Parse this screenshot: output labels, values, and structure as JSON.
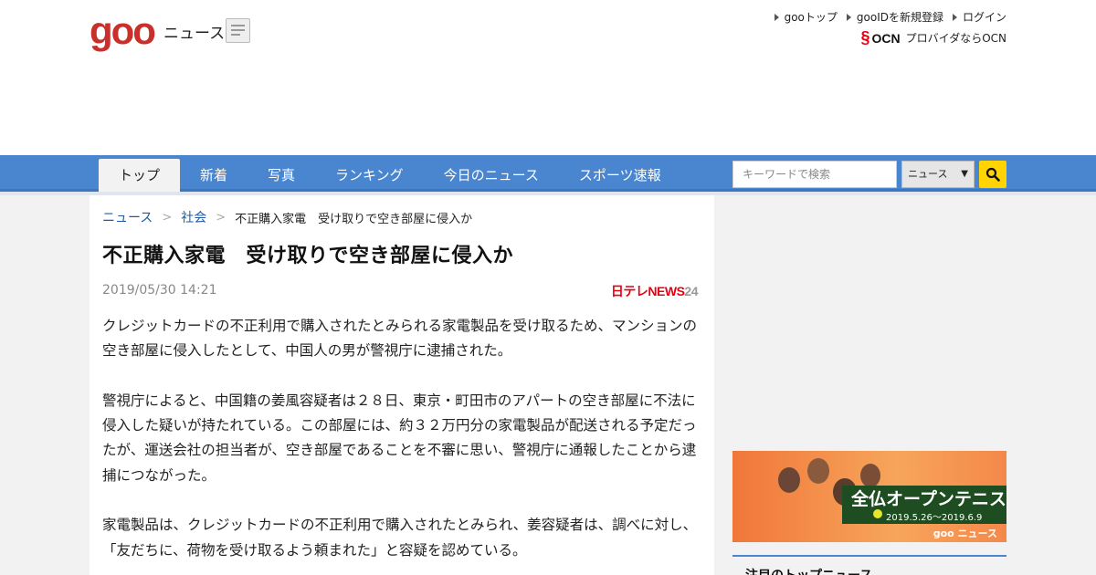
{
  "header": {
    "logo_text": "goo",
    "service_name": "ニュース",
    "util_links": [
      "gooトップ",
      "gooIDを新規登録",
      "ログイン"
    ],
    "ocn_logo": "OCN",
    "ocn_text": "プロバイダならOCN"
  },
  "nav": {
    "tabs": [
      "トップ",
      "新着",
      "写真",
      "ランキング",
      "今日のニュース",
      "スポーツ速報"
    ],
    "active_tab": "トップ",
    "search_placeholder": "キーワードで検索",
    "search_scope": "ニュース"
  },
  "breadcrumb": {
    "items": [
      "ニュース",
      "社会"
    ],
    "current": "不正購入家電　受け取りで空き部屋に侵入か"
  },
  "article": {
    "title": "不正購入家電　受け取りで空き部屋に侵入か",
    "date": "2019/05/30 14:21",
    "source_logo_red": "日テレNEWS",
    "source_logo_gray": "24",
    "paragraphs": [
      "クレジットカードの不正利用で購入されたとみられる家電製品を受け取るため、マンションの空き部屋に侵入したとして、中国人の男が警視庁に逮捕された。",
      "警視庁によると、中国籍の姜風容疑者は２８日、東京・町田市のアパートの空き部屋に不法に侵入した疑いが持たれている。この部屋には、約３２万円分の家電製品が配送される予定だったが、運送会社の担当者が、空き部屋であることを不審に思い、警視庁に通報したことから逮捕につながった。",
      "家電製品は、クレジットカードの不正利用で購入されたとみられ、姜容疑者は、調べに対し、「友だちに、荷物を受け取るよう頼まれた」と容疑を認めている。"
    ]
  },
  "sidebar": {
    "ad_title": "全仏オープンテニス",
    "ad_date": "2019.5.26〜2019.6.9",
    "ad_brand": "goo ニュース",
    "section_heading": "注目のトップニュース"
  },
  "colors": {
    "nav_blue": "#4a86d0",
    "logo_red": "#c9302c",
    "search_yellow": "#ffd400",
    "link_blue": "#1f5aa6"
  }
}
